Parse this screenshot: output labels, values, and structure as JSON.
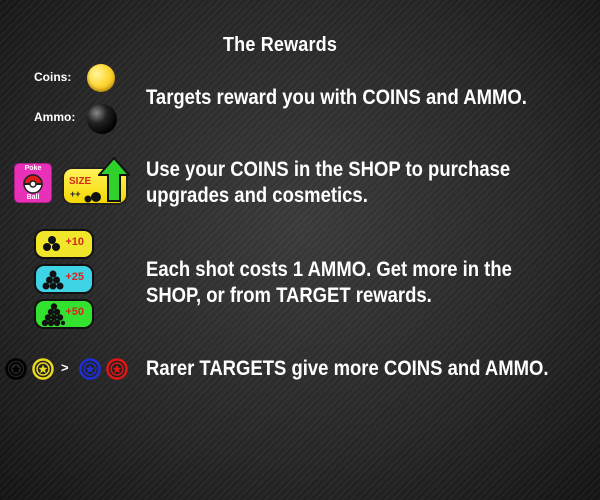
{
  "title": "The Rewards",
  "currency": {
    "coins_label": "Coins:",
    "ammo_label": "Ammo:"
  },
  "rows": [
    {
      "text": "Targets reward you with COINS and AMMO."
    },
    {
      "line1": "Use your COINS in the SHOP to purchase",
      "line2": "upgrades and cosmetics."
    },
    {
      "line1": "Each shot costs 1 AMMO. Get more in the",
      "line2": "SHOP, or from TARGET rewards."
    },
    {
      "text": "Rarer TARGETS give more COINS and AMMO."
    }
  ],
  "shop_icons": {
    "pokeball_top": "Poke",
    "pokeball_bottom": "Ball",
    "size_label": "SIZE",
    "size_plus": "++"
  },
  "ammo_packs": [
    {
      "amount": "+10",
      "color": "#f1e72a"
    },
    {
      "amount": "+25",
      "color": "#3fd3e6"
    },
    {
      "amount": "+50",
      "color": "#33e12f"
    }
  ],
  "targets": {
    "compare": ">",
    "common_colors": [
      "#111111",
      "#e8d820"
    ],
    "rare_colors": [
      "#1f2fd8",
      "#e01515"
    ]
  }
}
